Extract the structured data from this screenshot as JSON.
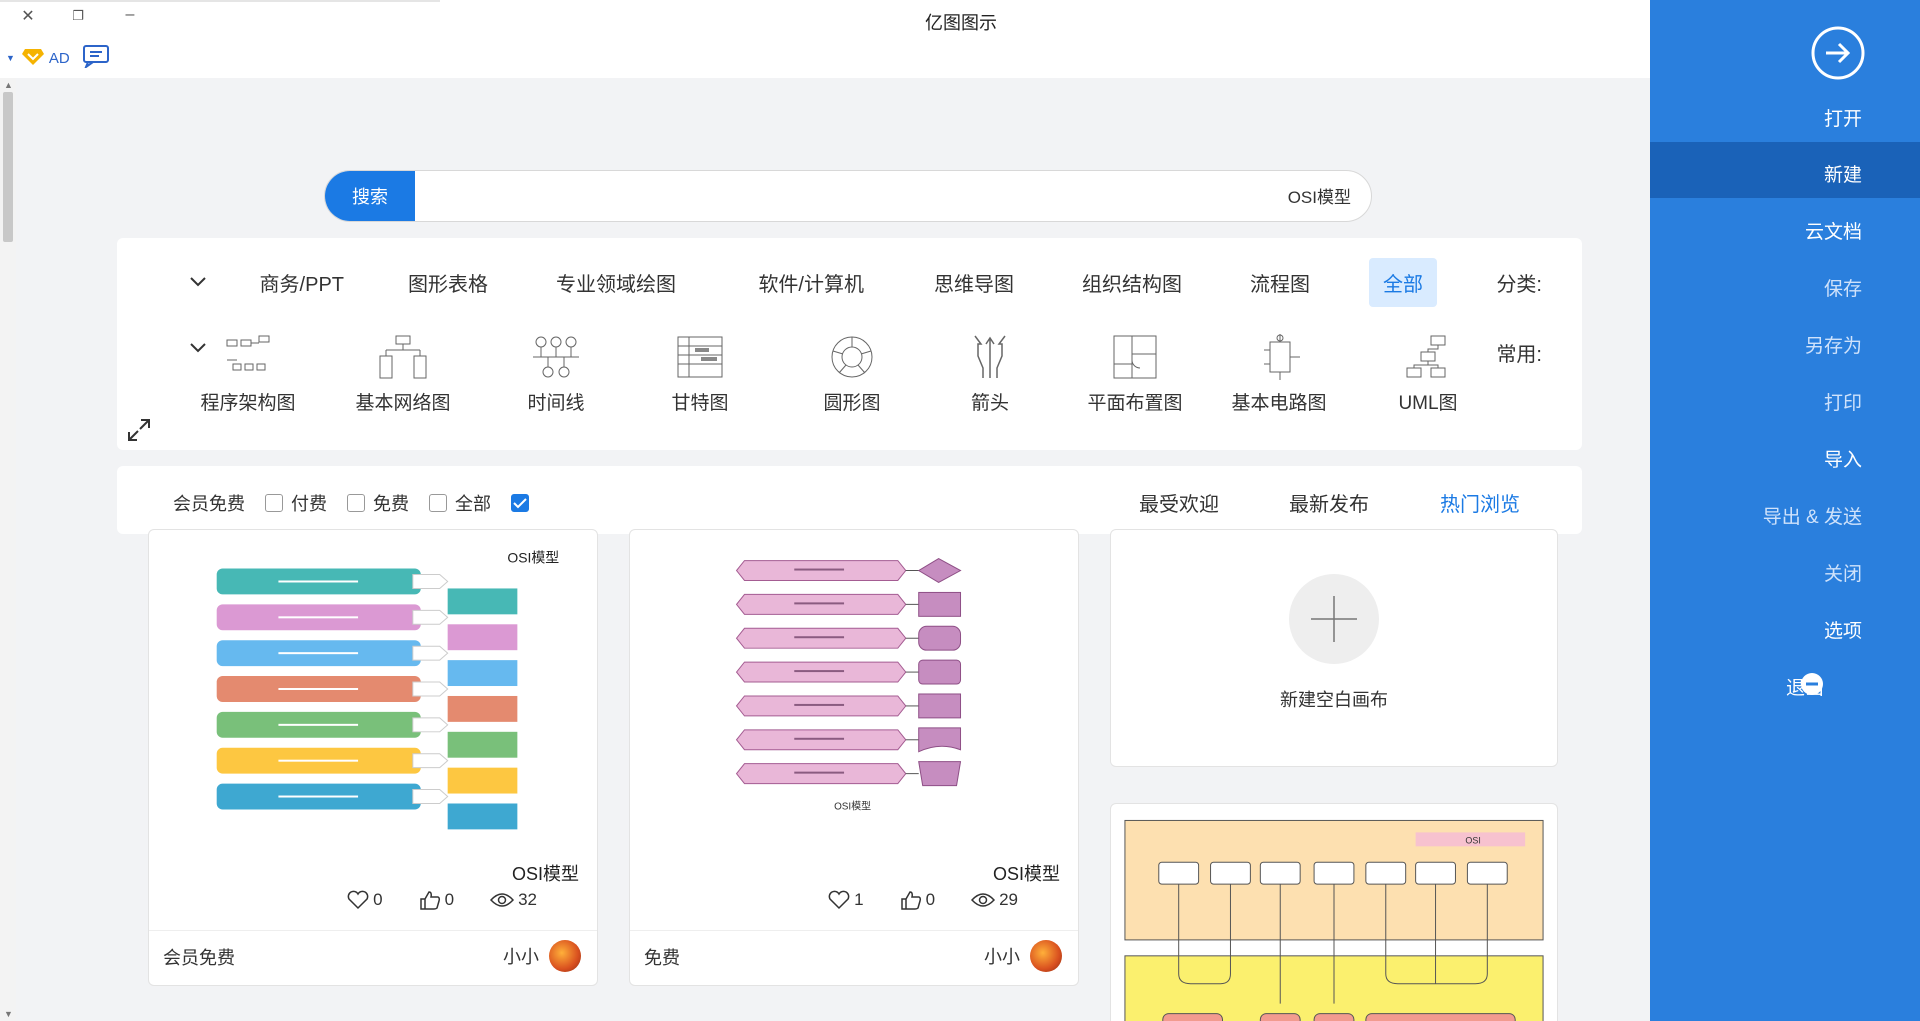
{
  "window": {
    "title": "亿图图示",
    "ad_label": "AD"
  },
  "search": {
    "button_label": "搜索",
    "value": "OSI模型"
  },
  "categories": {
    "label": "分类:",
    "items": [
      "全部",
      "流程图",
      "组织结构图",
      "思维导图",
      "软件/计算机",
      "专业领域绘图",
      "图形表格",
      "商务/PPT"
    ],
    "active": "全部"
  },
  "common": {
    "label": "常用:",
    "items": [
      {
        "label": "UML图",
        "icon": "uml-icon"
      },
      {
        "label": "基本电路图",
        "icon": "circuit-icon"
      },
      {
        "label": "平面布置图",
        "icon": "floorplan-icon"
      },
      {
        "label": "箭头",
        "icon": "arrows-icon"
      },
      {
        "label": "圆形图",
        "icon": "circle-diagram-icon"
      },
      {
        "label": "甘特图",
        "icon": "gantt-icon"
      },
      {
        "label": "时间线",
        "icon": "timeline-icon"
      },
      {
        "label": "基本网络图",
        "icon": "network-icon"
      },
      {
        "label": "程序架构图",
        "icon": "program-architecture-icon"
      }
    ]
  },
  "sort": {
    "tabs": [
      "热门浏览",
      "最新发布",
      "最受欢迎"
    ],
    "active": "热门浏览"
  },
  "filters": [
    {
      "label": "全部",
      "checked": true
    },
    {
      "label": "免费",
      "checked": false
    },
    {
      "label": "付费",
      "checked": false
    },
    {
      "label": "会员免费",
      "checked": false
    }
  ],
  "new_blank": {
    "label": "新建空白画布"
  },
  "cards": [
    {
      "title": "OSI模型",
      "views": "29",
      "likes": "0",
      "favorites": "1",
      "author": "小小",
      "price": "免费",
      "thumb_title": "OSI模型"
    },
    {
      "title": "OSI模型",
      "views": "32",
      "likes": "0",
      "favorites": "0",
      "author": "小小",
      "price": "会员免费",
      "thumb_title": "OSI模型"
    }
  ],
  "osi_thumb_title": "OSI",
  "sidebar": {
    "items": [
      "打开",
      "新建",
      "云文档",
      "保存",
      "另存为",
      "打印",
      "导入",
      "导出 & 发送",
      "关闭",
      "选项",
      "退出"
    ],
    "active": "新建",
    "accent": "#2a7fdd",
    "active_bg": "#1a62b8"
  },
  "colors": {
    "primary": "#1b7ae4"
  }
}
